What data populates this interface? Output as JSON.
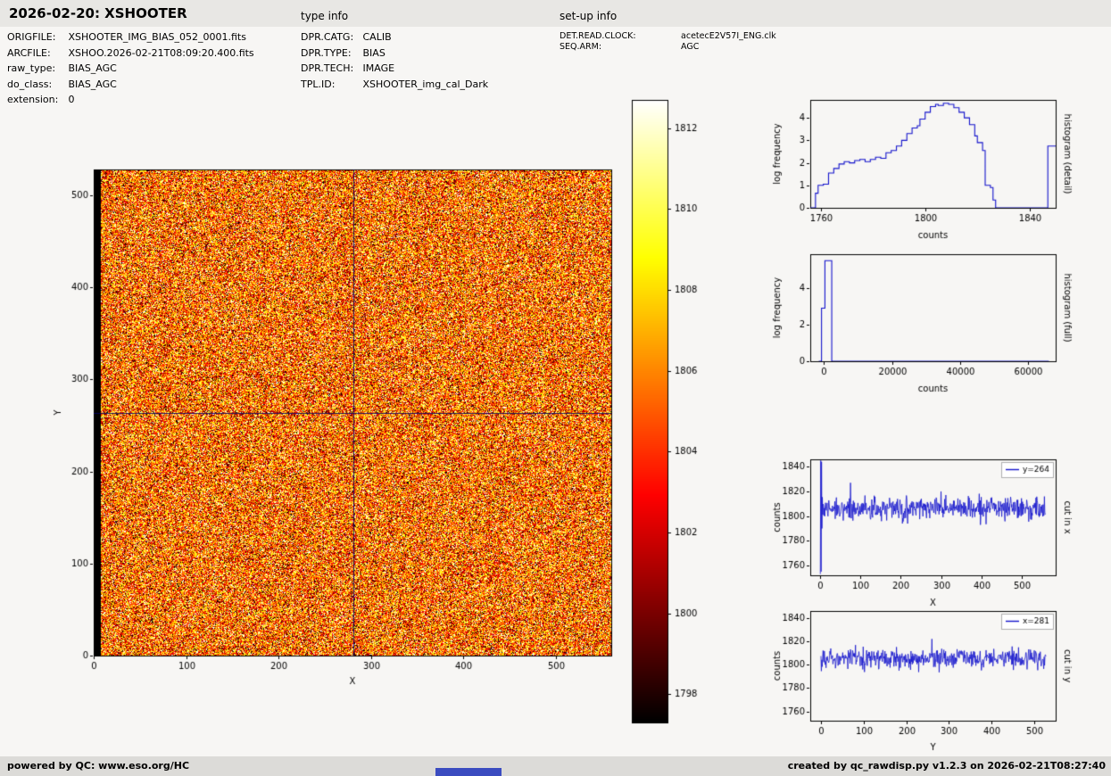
{
  "header": {
    "title": "2026-02-20: XSHOOTER",
    "type_info": "type info",
    "setup_info": "set-up info"
  },
  "metadata": {
    "file": [
      {
        "label": "ORIGFILE:",
        "value": "XSHOOTER_IMG_BIAS_052_0001.fits"
      },
      {
        "label": "ARCFILE:",
        "value": "XSHOO.2026-02-21T08:09:20.400.fits"
      },
      {
        "label": "raw_type:",
        "value": "BIAS_AGC"
      },
      {
        "label": "do_class:",
        "value": "BIAS_AGC"
      },
      {
        "label": "extension:",
        "value": "0"
      }
    ],
    "type": [
      {
        "label": "DPR.CATG:",
        "value": "CALIB"
      },
      {
        "label": "DPR.TYPE:",
        "value": "BIAS"
      },
      {
        "label": "DPR.TECH:",
        "value": "IMAGE"
      },
      {
        "label": "TPL.ID:",
        "value": "XSHOOTER_img_cal_Dark"
      }
    ],
    "setup": [
      {
        "label": "DET.READ.CLOCK:",
        "value": "acetecE2V57I_ENG.clk"
      },
      {
        "label": "SEQ.ARM:",
        "value": "AGC"
      }
    ]
  },
  "footer": {
    "left": "powered by QC: www.eso.org/HC",
    "right": "created by qc_rawdisp.py v1.2.3 on 2026-02-21T08:27:40"
  },
  "colors": {
    "line_blue": "#1414cc",
    "crosshair": "#000066",
    "accent_bar": "#3b4cc0"
  },
  "chart_data": [
    {
      "id": "main_image",
      "type": "heatmap",
      "xlabel": "X",
      "ylabel": "Y",
      "xlim": [
        0,
        560
      ],
      "ylim": [
        0,
        528
      ],
      "xticks": [
        0,
        100,
        200,
        300,
        400,
        500
      ],
      "yticks": [
        0,
        100,
        200,
        300,
        400,
        500
      ],
      "vmin": 1797.3,
      "vmax": 1812.7,
      "colormap": "hot",
      "noise_mean": 1805.5,
      "noise_std": 4.2,
      "dark_edge_columns": 7,
      "crosshair": {
        "x": 281,
        "y": 264
      }
    },
    {
      "id": "colorbar",
      "type": "colorbar",
      "colormap": "hot",
      "vmin": 1797.3,
      "vmax": 1812.7,
      "ticks": [
        1798,
        1800,
        1802,
        1804,
        1806,
        1808,
        1810,
        1812
      ]
    },
    {
      "id": "hist_detail",
      "type": "line",
      "style": "step",
      "xlabel": "counts",
      "ylabel": "log frequency",
      "right_label": "histogram (detail)",
      "xlim": [
        1756,
        1850
      ],
      "ylim": [
        0,
        4.8
      ],
      "xticks": [
        1760,
        1800,
        1840
      ],
      "yticks": [
        0,
        1,
        2,
        3,
        4
      ],
      "points": [
        [
          1756,
          0
        ],
        [
          1758,
          0.65
        ],
        [
          1759,
          1.0
        ],
        [
          1761,
          1.05
        ],
        [
          1763,
          1.55
        ],
        [
          1765,
          1.75
        ],
        [
          1767,
          1.95
        ],
        [
          1769,
          2.05
        ],
        [
          1771,
          2.0
        ],
        [
          1773,
          2.1
        ],
        [
          1775,
          2.15
        ],
        [
          1777,
          2.05
        ],
        [
          1779,
          2.15
        ],
        [
          1781,
          2.25
        ],
        [
          1783,
          2.2
        ],
        [
          1785,
          2.45
        ],
        [
          1787,
          2.55
        ],
        [
          1789,
          2.75
        ],
        [
          1791,
          3.0
        ],
        [
          1793,
          3.3
        ],
        [
          1795,
          3.55
        ],
        [
          1797,
          3.65
        ],
        [
          1798,
          3.95
        ],
        [
          1800,
          4.25
        ],
        [
          1802,
          4.5
        ],
        [
          1804,
          4.6
        ],
        [
          1805,
          4.55
        ],
        [
          1807,
          4.65
        ],
        [
          1809,
          4.6
        ],
        [
          1811,
          4.45
        ],
        [
          1813,
          4.25
        ],
        [
          1815,
          4.0
        ],
        [
          1817,
          3.7
        ],
        [
          1819,
          3.2
        ],
        [
          1820,
          2.9
        ],
        [
          1822,
          2.55
        ],
        [
          1823,
          1.0
        ],
        [
          1825,
          0.9
        ],
        [
          1826,
          0.35
        ],
        [
          1827,
          0
        ],
        [
          1846,
          0
        ],
        [
          1847,
          2.75
        ],
        [
          1850,
          2.75
        ]
      ]
    },
    {
      "id": "hist_full",
      "type": "line",
      "style": "step",
      "xlabel": "counts",
      "ylabel": "log frequency",
      "right_label": "histogram (full)",
      "xlim": [
        -4000,
        68000
      ],
      "ylim": [
        0,
        5.85
      ],
      "xticks": [
        0,
        20000,
        40000,
        60000
      ],
      "yticks": [
        0,
        2,
        4
      ],
      "points": [
        [
          -1500,
          0
        ],
        [
          -700,
          2.9
        ],
        [
          300,
          5.5
        ],
        [
          2300,
          0
        ],
        [
          66000,
          0
        ]
      ]
    },
    {
      "id": "cut_x",
      "type": "line",
      "style": "noisy",
      "xlabel": "X",
      "ylabel": "counts",
      "right_label": "cut in x",
      "legend": "y=264",
      "xlim": [
        -25,
        585
      ],
      "ylim": [
        1752,
        1846
      ],
      "xticks": [
        0,
        100,
        200,
        300,
        400,
        500
      ],
      "yticks": [
        1760,
        1780,
        1800,
        1820,
        1840
      ],
      "n": 560,
      "noise_mean": 1806,
      "noise_std": 4.3,
      "edge_values": [
        1753,
        1845,
        1755,
        1844,
        1790
      ],
      "spikes": [
        [
          75,
          1827
        ],
        [
          300,
          1820
        ]
      ]
    },
    {
      "id": "cut_y",
      "type": "line",
      "style": "noisy",
      "xlabel": "Y",
      "ylabel": "counts",
      "right_label": "cut in y",
      "legend": "x=281",
      "xlim": [
        -25,
        550
      ],
      "ylim": [
        1752,
        1846
      ],
      "xticks": [
        0,
        100,
        200,
        300,
        400,
        500
      ],
      "yticks": [
        1760,
        1780,
        1800,
        1820,
        1840
      ],
      "n": 528,
      "noise_mean": 1805,
      "noise_std": 4.2,
      "edge_values": [],
      "spikes": [
        [
          260,
          1822
        ]
      ]
    }
  ]
}
